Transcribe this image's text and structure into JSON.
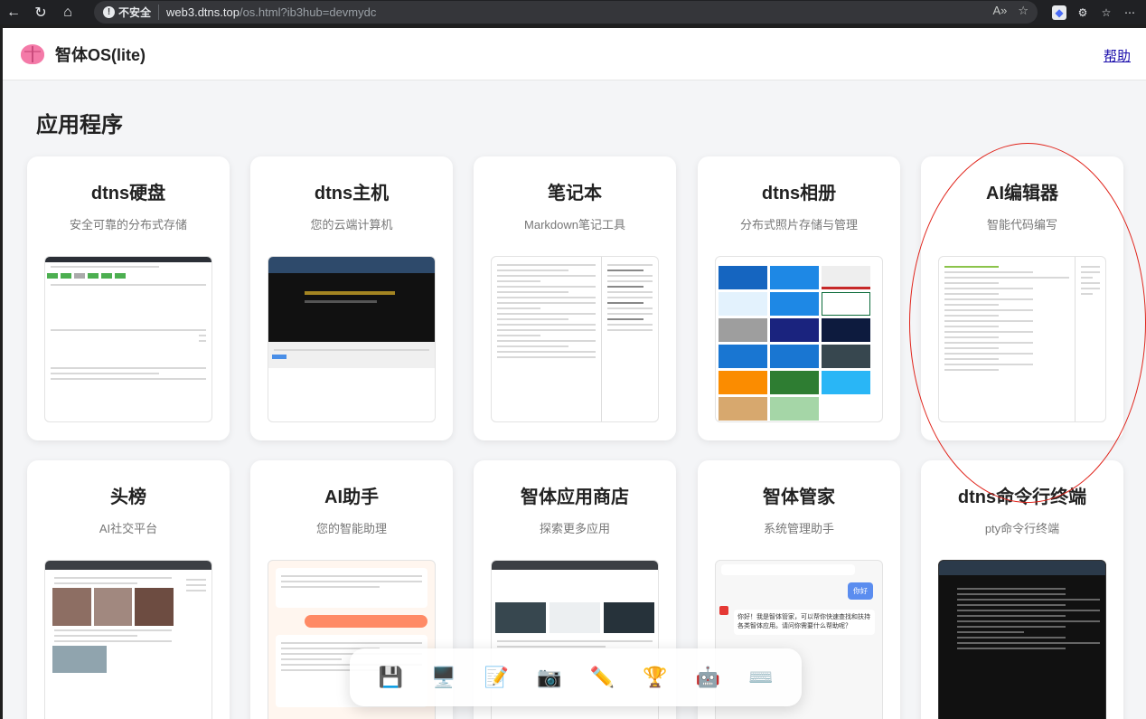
{
  "browser": {
    "insecure_label": "不安全",
    "url_host": "web3.dtns.top",
    "url_path": "/os.html?ib3hub=devmydc"
  },
  "header": {
    "app_title": "智体OS(lite)",
    "help_label": "帮助"
  },
  "section_title": "应用程序",
  "apps": [
    {
      "title": "dtns硬盘",
      "subtitle": "安全可靠的分布式存储"
    },
    {
      "title": "dtns主机",
      "subtitle": "您的云端计算机"
    },
    {
      "title": "笔记本",
      "subtitle": "Markdown笔记工具"
    },
    {
      "title": "dtns相册",
      "subtitle": "分布式照片存储与管理"
    },
    {
      "title": "AI编辑器",
      "subtitle": "智能代码编写"
    },
    {
      "title": "头榜",
      "subtitle": "AI社交平台"
    },
    {
      "title": "AI助手",
      "subtitle": "您的智能助理"
    },
    {
      "title": "智体应用商店",
      "subtitle": "探索更多应用"
    },
    {
      "title": "智体管家",
      "subtitle": "系统管理助手"
    },
    {
      "title": "dtns命令行终端",
      "subtitle": "pty命令行终端"
    }
  ],
  "previews": {
    "butler_greeting": "你好",
    "butler_reply": "你好！我是智体管家，可以帮你快速查找和扶持各类智体应用。请问你需要什么帮助呢？"
  },
  "dock": [
    {
      "icon": "floppy-disk-icon",
      "glyph": "💾"
    },
    {
      "icon": "monitor-icon",
      "glyph": "🖥️"
    },
    {
      "icon": "notepad-icon",
      "glyph": "📝"
    },
    {
      "icon": "camera-icon",
      "glyph": "📷"
    },
    {
      "icon": "pencil-icon",
      "glyph": "✏️"
    },
    {
      "icon": "trophy-icon",
      "glyph": "🏆"
    },
    {
      "icon": "robot-icon",
      "glyph": "🤖"
    },
    {
      "icon": "keyboard-icon",
      "glyph": "⌨️"
    }
  ]
}
